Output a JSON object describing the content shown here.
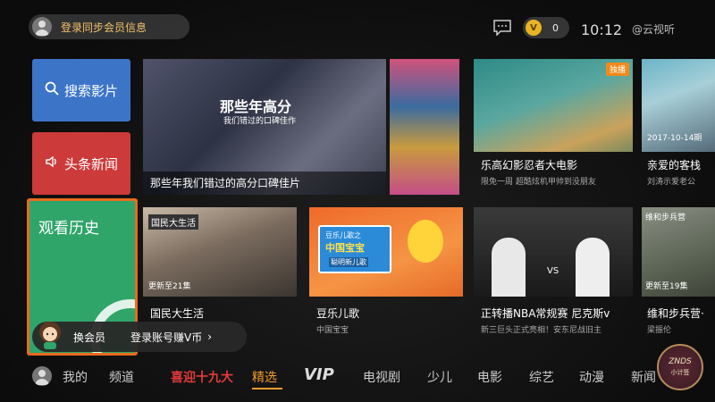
{
  "header": {
    "login_text": "登录同步会员信息",
    "coin_symbol": "V",
    "coin_count": "0",
    "clock": "10:12",
    "brand": "@云视听"
  },
  "side": {
    "search_label": "搜索影片",
    "news_label": "头条新闻",
    "history_label": "观看历史"
  },
  "cards": {
    "hero": {
      "overlay_title": "那些年高分",
      "overlay_sub": "我们错过的口碑佳作",
      "caption": "那些年我们错过的高分口碑佳片"
    },
    "ninja": {
      "badge": "独播",
      "title": "乐高幻影忍者大电影",
      "sub": "限免一周 超酷炫机甲帅到没朋友"
    },
    "kezhan": {
      "date": "2017-10-14期",
      "title": "亲爱的客栈",
      "sub": "刘涛示爱老公"
    },
    "guomin": {
      "tag": "国民大生活",
      "update": "更新至21集",
      "title": "国民大生活"
    },
    "erge": {
      "sign_top": "豆乐儿歌之",
      "sign_main": "中国宝宝",
      "sign_bottom": "聪明新儿歌",
      "title": "豆乐儿歌",
      "sub": "中国宝宝"
    },
    "nba": {
      "vs": "VS",
      "title": "正转播NBA常规赛 尼克斯v",
      "sub": "新三巨头正式亮相！安东尼战旧主"
    },
    "weihe": {
      "tag": "维和步兵营",
      "update": "更新至19集",
      "title": "维和步兵营·",
      "sub": "梁振伦"
    }
  },
  "vip_promo": {
    "label": "换会员",
    "action": "登录账号赚V币",
    "chevron": "›"
  },
  "nav": {
    "items": [
      "我的",
      "频道",
      "喜迎十九大",
      "精选",
      "VIP",
      "电视剧",
      "少儿",
      "电影",
      "综艺",
      "动漫",
      "新闻"
    ],
    "active": "精选"
  },
  "watermark": {
    "top": "ZNDS",
    "bottom": "小计签"
  },
  "colors": {
    "accent": "#f29a2e",
    "search": "#3c74c8",
    "news": "#cc3a3a",
    "history": "#2fa56a",
    "coin": "#e9b421"
  }
}
